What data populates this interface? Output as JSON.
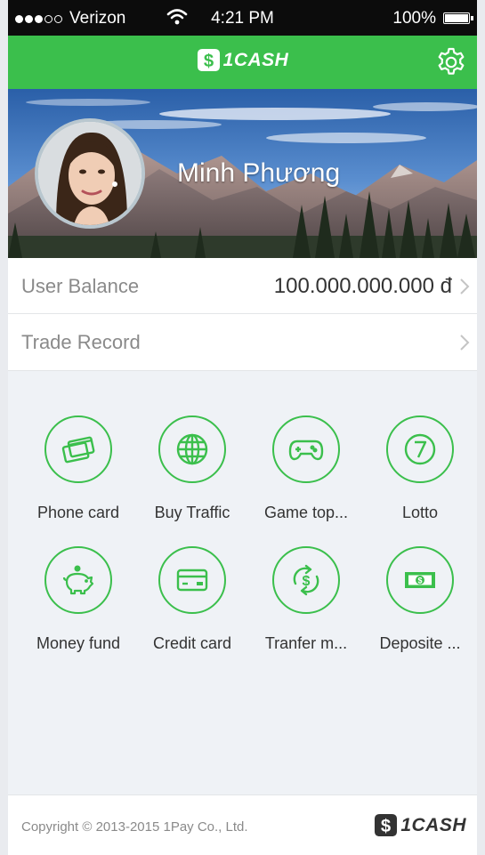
{
  "status_bar": {
    "carrier": "Verizon",
    "signal_dots": [
      true,
      true,
      true,
      false,
      false
    ],
    "time": "4:21 PM",
    "battery": "100%"
  },
  "nav": {
    "brand": "1CASH",
    "settings_icon": "gear-icon"
  },
  "profile": {
    "name": "Minh Phương"
  },
  "rows": {
    "balance": {
      "label": "User Balance",
      "value": "100.000.000.000 đ"
    },
    "trade": {
      "label": "Trade Record"
    }
  },
  "services": [
    {
      "label": "Phone card",
      "icon": "phone-card-icon"
    },
    {
      "label": "Buy Traffic",
      "icon": "globe-icon"
    },
    {
      "label": "Game top...",
      "icon": "gamepad-icon"
    },
    {
      "label": "Lotto",
      "icon": "lotto-seven-icon"
    },
    {
      "label": "Money fund",
      "icon": "piggy-bank-icon"
    },
    {
      "label": "Credit card",
      "icon": "credit-card-icon"
    },
    {
      "label": "Tranfer m...",
      "icon": "transfer-money-icon"
    },
    {
      "label": "Deposite ...",
      "icon": "banknote-icon"
    }
  ],
  "footer": {
    "copyright": "Copyright © 2013-2015 1Pay Co., Ltd.",
    "brand": "1CASH"
  },
  "colors": {
    "accent": "#3bbf4c",
    "status_bar": "#0c0c0c",
    "background": "#eff2f6"
  }
}
